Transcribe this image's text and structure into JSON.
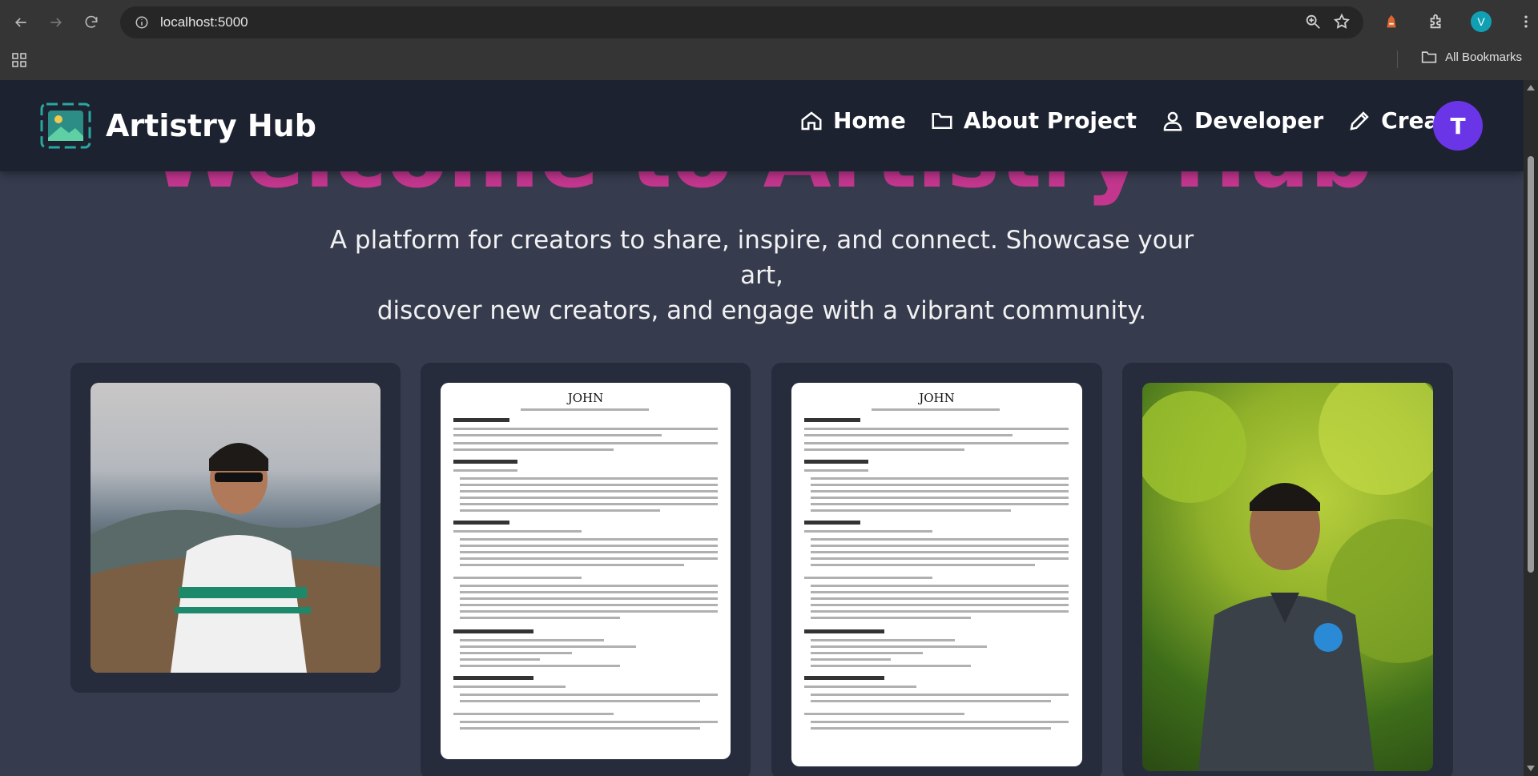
{
  "browser": {
    "url": "localhost:5000",
    "profile_initial": "V",
    "bookmarks_label": "All Bookmarks"
  },
  "site": {
    "brand": "Artistry Hub",
    "nav": [
      {
        "label": "Home",
        "icon": "home-icon"
      },
      {
        "label": "About Project",
        "icon": "folder-icon"
      },
      {
        "label": "Developer",
        "icon": "user-icon"
      },
      {
        "label": "Create",
        "icon": "pencil-icon"
      }
    ],
    "avatar_initial": "T"
  },
  "hero": {
    "title": "Welcome to Artistry Hub",
    "subtitle_line1": "A platform for creators to share, inspire, and connect. Showcase your art,",
    "subtitle_line2": "discover new creators, and engage with a vibrant community."
  },
  "gallery": [
    {
      "type": "photo",
      "subject": "man-in-sunglasses-photo"
    },
    {
      "type": "resume",
      "name": "JOHN"
    },
    {
      "type": "resume",
      "name": "JOHN"
    },
    {
      "type": "photo",
      "subject": "man-in-polo-photo"
    }
  ],
  "colors": {
    "nav_bg": "#1c2230",
    "page_bg": "#363c4e",
    "card_bg": "#262c3b",
    "avatar_bg": "#6a35e6",
    "title_color": "#c2368e"
  }
}
